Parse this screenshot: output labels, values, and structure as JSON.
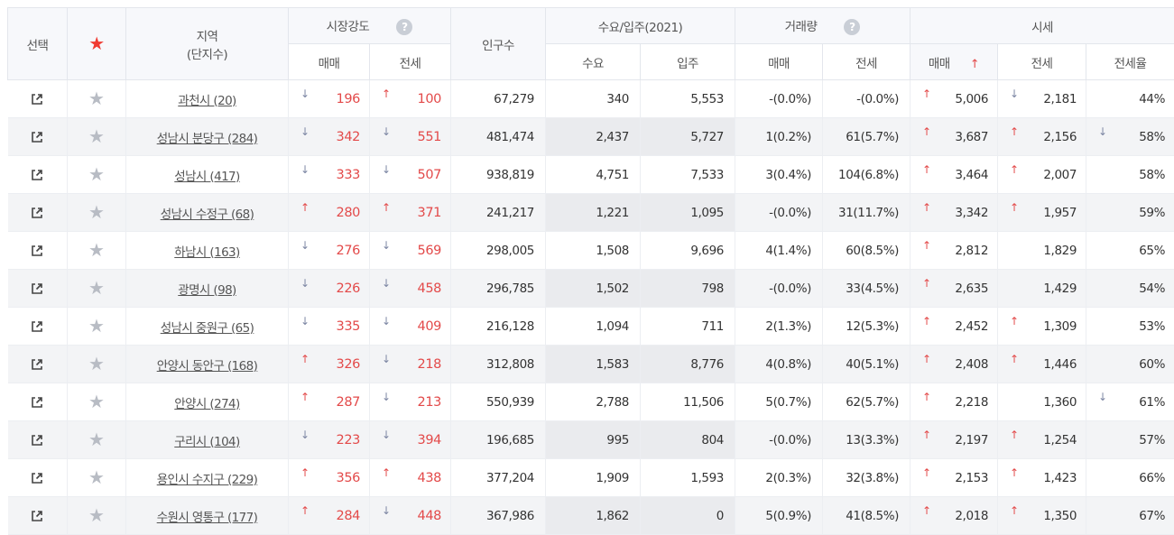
{
  "header": {
    "select": "선택",
    "region_line1": "지역",
    "region_line2": "(단지수)",
    "market_strength": "시장강도",
    "population": "인구수",
    "demand_supply": "수요/입주(2021)",
    "trade_volume": "거래량",
    "price": "시세",
    "sale": "매매",
    "jeonse": "전세",
    "demand": "수요",
    "supply": "입주",
    "jeonse_ratio": "전세율",
    "help_glyph": "?"
  },
  "icons": {
    "external": "external-link-icon",
    "star": "star-icon",
    "help": "help-icon",
    "up": "arrow-up-icon",
    "down": "arrow-down-icon"
  },
  "colors": {
    "red": "#e34a4a",
    "down_arrow": "#7c86a3",
    "star_active": "#f03b32"
  },
  "rows": [
    {
      "region": "과천시 (20)",
      "ms_sale_dir": "down",
      "ms_sale": "196",
      "ms_jeonse_dir": "up",
      "ms_jeonse": "100",
      "population": "67,279",
      "demand": "340",
      "supply": "5,553",
      "tv_sale": "-(0.0%)",
      "tv_jeonse": "-(0.0%)",
      "p_sale_dir": "up",
      "p_sale": "5,006",
      "p_jeonse_dir": "down",
      "p_jeonse": "2,181",
      "ratio_dir": "",
      "ratio": "44%"
    },
    {
      "region": "성남시 분당구 (284)",
      "ms_sale_dir": "down",
      "ms_sale": "342",
      "ms_jeonse_dir": "down",
      "ms_jeonse": "551",
      "population": "481,474",
      "demand": "2,437",
      "supply": "5,727",
      "tv_sale": "1(0.2%)",
      "tv_jeonse": "61(5.7%)",
      "p_sale_dir": "up",
      "p_sale": "3,687",
      "p_jeonse_dir": "up",
      "p_jeonse": "2,156",
      "ratio_dir": "down",
      "ratio": "58%"
    },
    {
      "region": "성남시 (417)",
      "ms_sale_dir": "down",
      "ms_sale": "333",
      "ms_jeonse_dir": "down",
      "ms_jeonse": "507",
      "population": "938,819",
      "demand": "4,751",
      "supply": "7,533",
      "tv_sale": "3(0.4%)",
      "tv_jeonse": "104(6.8%)",
      "p_sale_dir": "up",
      "p_sale": "3,464",
      "p_jeonse_dir": "up",
      "p_jeonse": "2,007",
      "ratio_dir": "",
      "ratio": "58%"
    },
    {
      "region": "성남시 수정구 (68)",
      "ms_sale_dir": "up",
      "ms_sale": "280",
      "ms_jeonse_dir": "up",
      "ms_jeonse": "371",
      "population": "241,217",
      "demand": "1,221",
      "supply": "1,095",
      "tv_sale": "-(0.0%)",
      "tv_jeonse": "31(11.7%)",
      "p_sale_dir": "up",
      "p_sale": "3,342",
      "p_jeonse_dir": "up",
      "p_jeonse": "1,957",
      "ratio_dir": "",
      "ratio": "59%"
    },
    {
      "region": "하남시 (163)",
      "ms_sale_dir": "down",
      "ms_sale": "276",
      "ms_jeonse_dir": "down",
      "ms_jeonse": "569",
      "population": "298,005",
      "demand": "1,508",
      "supply": "9,696",
      "tv_sale": "4(1.4%)",
      "tv_jeonse": "60(8.5%)",
      "p_sale_dir": "up",
      "p_sale": "2,812",
      "p_jeonse_dir": "",
      "p_jeonse": "1,829",
      "ratio_dir": "",
      "ratio": "65%"
    },
    {
      "region": "광명시 (98)",
      "ms_sale_dir": "down",
      "ms_sale": "226",
      "ms_jeonse_dir": "down",
      "ms_jeonse": "458",
      "population": "296,785",
      "demand": "1,502",
      "supply": "798",
      "tv_sale": "-(0.0%)",
      "tv_jeonse": "33(4.5%)",
      "p_sale_dir": "up",
      "p_sale": "2,635",
      "p_jeonse_dir": "",
      "p_jeonse": "1,429",
      "ratio_dir": "",
      "ratio": "54%"
    },
    {
      "region": "성남시 중원구 (65)",
      "ms_sale_dir": "down",
      "ms_sale": "335",
      "ms_jeonse_dir": "down",
      "ms_jeonse": "409",
      "population": "216,128",
      "demand": "1,094",
      "supply": "711",
      "tv_sale": "2(1.3%)",
      "tv_jeonse": "12(5.3%)",
      "p_sale_dir": "up",
      "p_sale": "2,452",
      "p_jeonse_dir": "up",
      "p_jeonse": "1,309",
      "ratio_dir": "",
      "ratio": "53%"
    },
    {
      "region": "안양시 동안구 (168)",
      "ms_sale_dir": "up",
      "ms_sale": "326",
      "ms_jeonse_dir": "down",
      "ms_jeonse": "218",
      "population": "312,808",
      "demand": "1,583",
      "supply": "8,776",
      "tv_sale": "4(0.8%)",
      "tv_jeonse": "40(5.1%)",
      "p_sale_dir": "up",
      "p_sale": "2,408",
      "p_jeonse_dir": "up",
      "p_jeonse": "1,446",
      "ratio_dir": "",
      "ratio": "60%"
    },
    {
      "region": "안양시 (274)",
      "ms_sale_dir": "up",
      "ms_sale": "287",
      "ms_jeonse_dir": "down",
      "ms_jeonse": "213",
      "population": "550,939",
      "demand": "2,788",
      "supply": "11,506",
      "tv_sale": "5(0.7%)",
      "tv_jeonse": "62(5.7%)",
      "p_sale_dir": "up",
      "p_sale": "2,218",
      "p_jeonse_dir": "",
      "p_jeonse": "1,360",
      "ratio_dir": "down",
      "ratio": "61%"
    },
    {
      "region": "구리시 (104)",
      "ms_sale_dir": "down",
      "ms_sale": "223",
      "ms_jeonse_dir": "down",
      "ms_jeonse": "394",
      "population": "196,685",
      "demand": "995",
      "supply": "804",
      "tv_sale": "-(0.0%)",
      "tv_jeonse": "13(3.3%)",
      "p_sale_dir": "up",
      "p_sale": "2,197",
      "p_jeonse_dir": "up",
      "p_jeonse": "1,254",
      "ratio_dir": "",
      "ratio": "57%"
    },
    {
      "region": "용인시 수지구 (229)",
      "ms_sale_dir": "up",
      "ms_sale": "356",
      "ms_jeonse_dir": "up",
      "ms_jeonse": "438",
      "population": "377,204",
      "demand": "1,909",
      "supply": "1,593",
      "tv_sale": "2(0.3%)",
      "tv_jeonse": "32(3.8%)",
      "p_sale_dir": "up",
      "p_sale": "2,153",
      "p_jeonse_dir": "up",
      "p_jeonse": "1,423",
      "ratio_dir": "",
      "ratio": "66%"
    },
    {
      "region": "수원시 영통구 (177)",
      "ms_sale_dir": "up",
      "ms_sale": "284",
      "ms_jeonse_dir": "down",
      "ms_jeonse": "448",
      "population": "367,986",
      "demand": "1,862",
      "supply": "0",
      "tv_sale": "5(0.9%)",
      "tv_jeonse": "41(8.5%)",
      "p_sale_dir": "up",
      "p_sale": "2,018",
      "p_jeonse_dir": "up",
      "p_jeonse": "1,350",
      "ratio_dir": "",
      "ratio": "67%"
    }
  ]
}
